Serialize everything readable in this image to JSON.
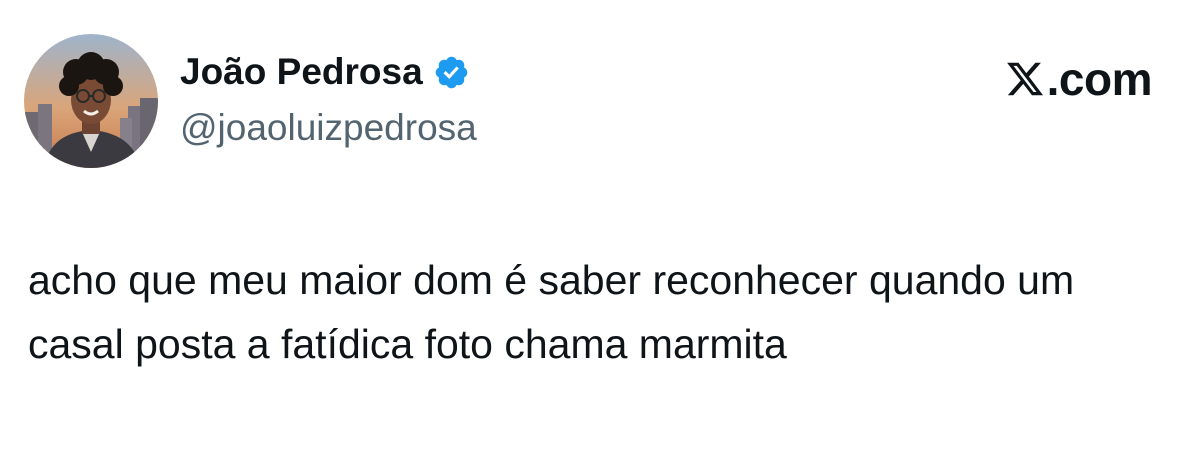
{
  "author": {
    "display_name": "João Pedrosa",
    "handle": "@joaoluizpedrosa",
    "verified_icon": "verified-badge-icon",
    "verified_color": "#1d9bf0"
  },
  "brand": {
    "icon": "x-logo-icon",
    "text": ".com"
  },
  "tweet": {
    "text": "acho que meu maior dom é saber reconhecer quando um casal posta a fatídica foto chama marmita"
  },
  "colors": {
    "text_primary": "#0f1419",
    "text_secondary": "#536471",
    "background": "#ffffff"
  }
}
